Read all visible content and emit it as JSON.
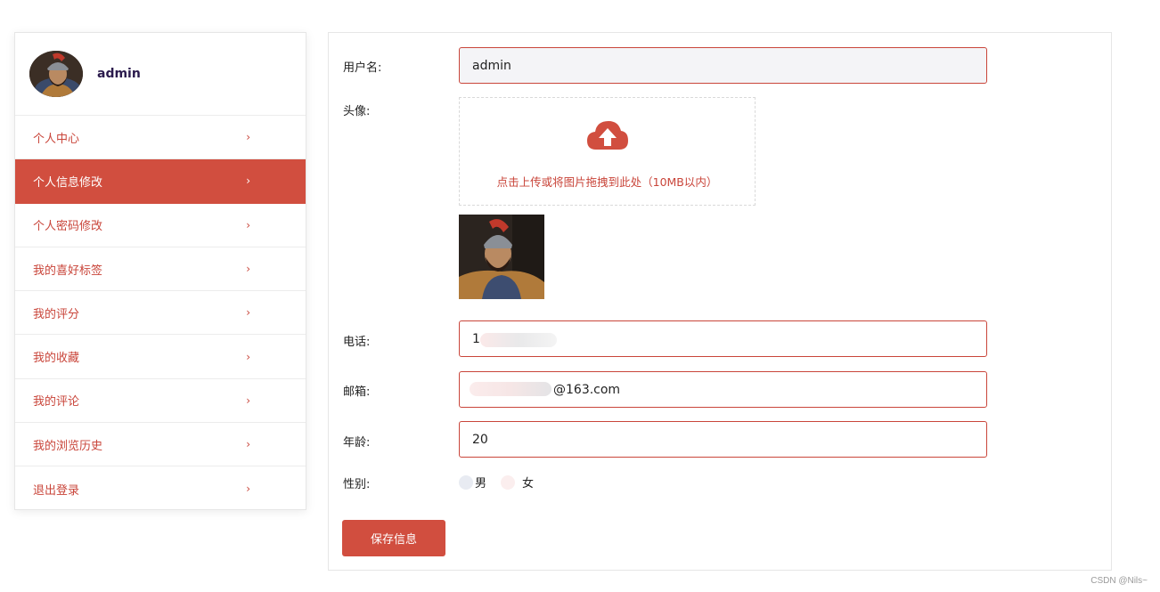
{
  "sidebar": {
    "username": "admin",
    "items": [
      {
        "label": "个人中心"
      },
      {
        "label": "个人信息修改"
      },
      {
        "label": "个人密码修改"
      },
      {
        "label": "我的喜好标签"
      },
      {
        "label": "我的评分"
      },
      {
        "label": "我的收藏"
      },
      {
        "label": "我的评论"
      },
      {
        "label": "我的浏览历史"
      },
      {
        "label": "退出登录"
      }
    ],
    "active_index": 1,
    "chevron": "chevron-right-icon"
  },
  "form": {
    "username_label": "用户名:",
    "username_value": "admin",
    "avatar_label": "头像:",
    "upload_text": "点击上传或将图片拖拽到此处（10MB以内）",
    "upload_icon": "cloud-upload-icon",
    "phone_label": "电话:",
    "phone_value": "1",
    "email_label": "邮箱:",
    "email_value": "@163.com",
    "age_label": "年龄:",
    "age_value": "20",
    "gender_label": "性别:",
    "gender_options": [
      "男",
      "女"
    ],
    "save_label": "保存信息"
  },
  "watermark": "CSDN @Nils~",
  "colors": {
    "accent": "#d14e3f",
    "accent_text": "#c9453a",
    "border": "#e6e6e6"
  }
}
